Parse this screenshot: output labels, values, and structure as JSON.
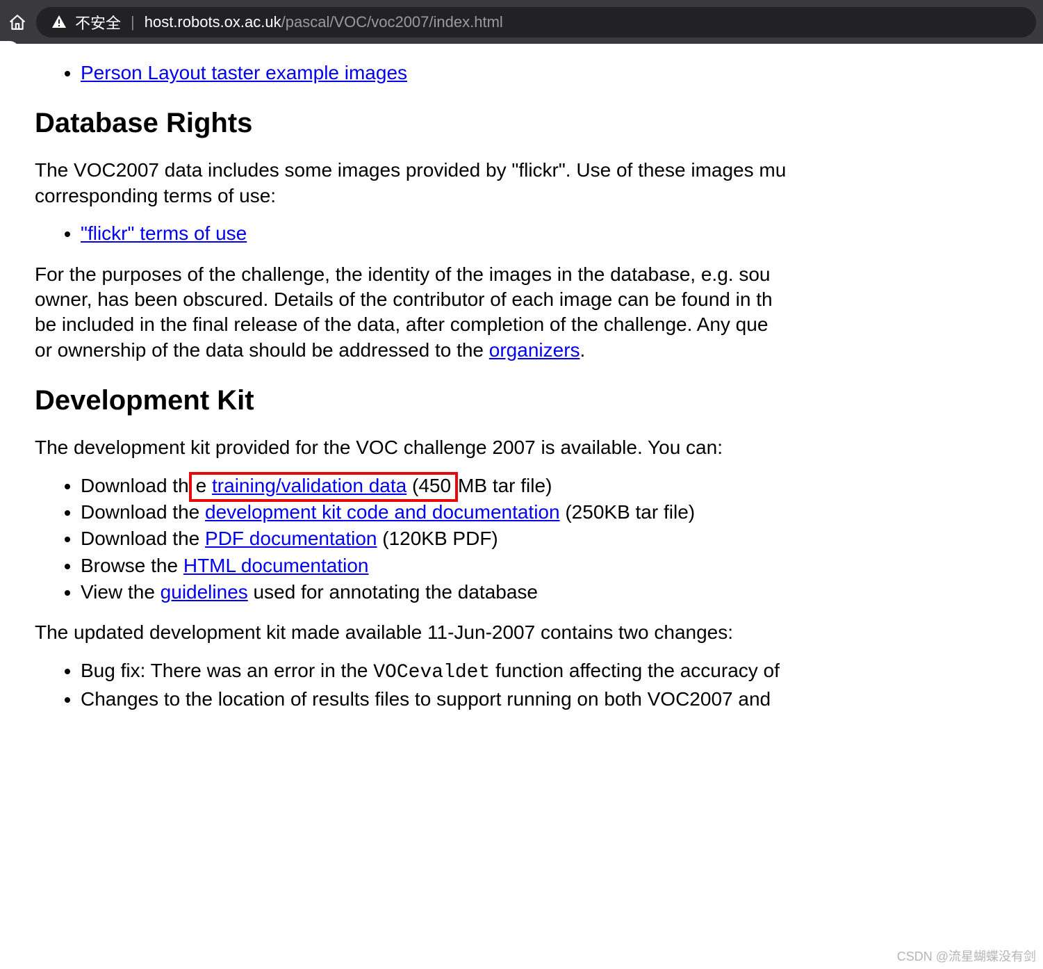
{
  "chrome": {
    "insecure_label": "不安全",
    "url_host": "host.robots.ox.ac.uk",
    "url_path": "/pascal/VOC/voc2007/index.html"
  },
  "links": {
    "top_link": "Person Layout taster example images",
    "flickr_terms": "\"flickr\" terms of use",
    "organizers": "organizers",
    "train_val": "training/validation data",
    "devkit": "development kit code and documentation",
    "pdfdoc": "PDF documentation",
    "htmldoc": "HTML documentation",
    "guidelines": "guidelines"
  },
  "headings": {
    "db_rights": "Database Rights",
    "dev_kit": "Development Kit"
  },
  "paras": {
    "db_intro": "The VOC2007 data includes some images provided by \"flickr\". Use of these images mu",
    "db_intro2": "corresponding terms of use:",
    "obscured1": "For the purposes of the challenge, the identity of the images in the database, e.g. sou",
    "obscured2": "owner, has been obscured. Details of the contributor of each image can be found in th",
    "obscured3": "be included in the final release of the data, after completion of the challenge. Any que",
    "obscured4_pre": "or ownership of the data should be addressed to the ",
    "obscured4_post": ".",
    "devkit_intro": "The development kit provided for the VOC challenge 2007 is available. You can:",
    "dl1_pre": "Download th",
    "dl1_post": "MB tar file)",
    "hl_e": "e ",
    "hl_paren": " (450",
    "dl2_pre": "Download the ",
    "dl2_post": " (250KB tar file)",
    "dl3_pre": "Download the ",
    "dl3_post": " (120KB PDF)",
    "dl4_pre": "Browse the ",
    "dl5_pre": "View the ",
    "dl5_post": " used for annotating the database",
    "updated": "The updated development kit made available 11-Jun-2007 contains two changes:",
    "bug1_pre": "Bug fix: There was an error in the ",
    "bug1_code": "VOCevaldet",
    "bug1_post": " function affecting the accuracy of",
    "bug2": "Changes to the location of results files to support running on both VOC2007 and"
  },
  "watermark": "CSDN @流星蝴蝶没有剑"
}
